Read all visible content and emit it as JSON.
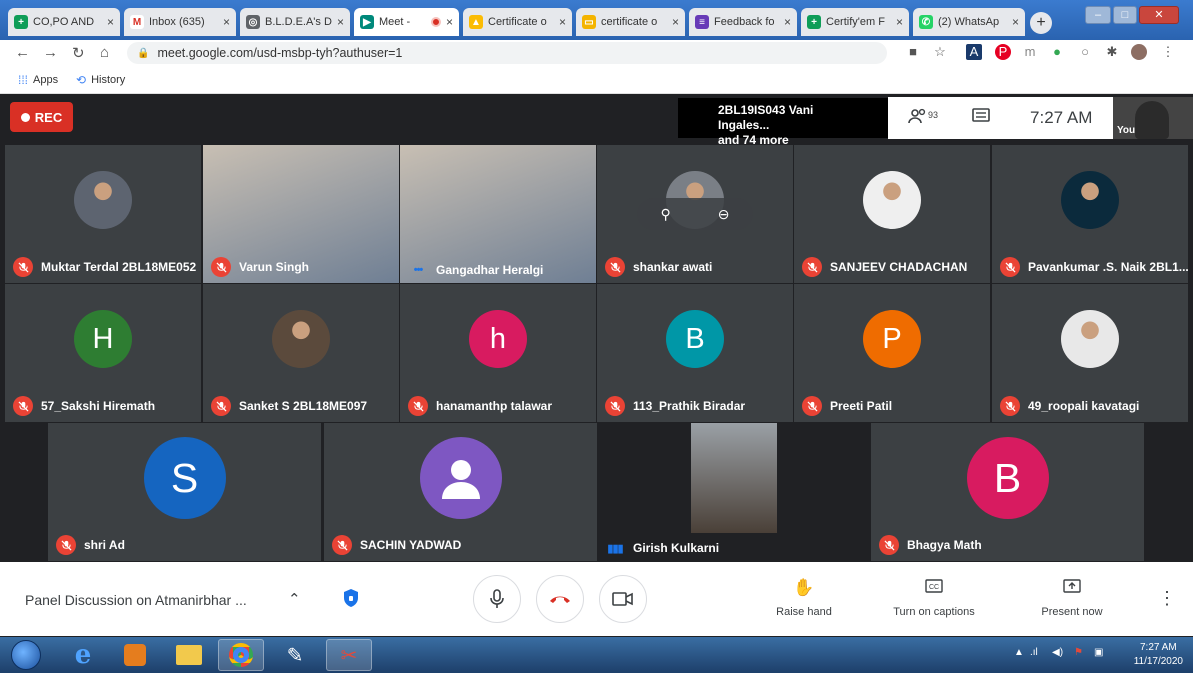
{
  "browser": {
    "tabs": [
      {
        "title": "CO,PO AND",
        "favicon": "sheets-icon",
        "color": "#0f9d58",
        "glyph": "+"
      },
      {
        "title": "Inbox (635)",
        "favicon": "gmail-icon",
        "color": "#ffffff",
        "glyph": "M"
      },
      {
        "title": "B.L.D.E.A's D",
        "favicon": "globe-icon",
        "color": "#5f6368",
        "glyph": "◎"
      },
      {
        "title": "Meet - ",
        "favicon": "meet-icon",
        "color": "#00897b",
        "glyph": "▶"
      },
      {
        "title": "Certificate o",
        "favicon": "drive-icon",
        "color": "#fbbc04",
        "glyph": "▲"
      },
      {
        "title": "certificate o",
        "favicon": "slides-icon",
        "color": "#f4b400",
        "glyph": "▭"
      },
      {
        "title": "Feedback fo",
        "favicon": "forms-icon",
        "color": "#673ab7",
        "glyph": "≡"
      },
      {
        "title": "Certify'em F",
        "favicon": "sheets-icon",
        "color": "#0f9d58",
        "glyph": "+"
      },
      {
        "title": "(2) WhatsAp",
        "favicon": "whatsapp-icon",
        "color": "#25d366",
        "glyph": "✆"
      }
    ],
    "tab_close": "×",
    "new_tab": "+",
    "url": "meet.google.com/usd-msbp-tyh?authuser=1",
    "bookmarks": [
      {
        "label": "Apps",
        "icon": "apps-grid-icon"
      },
      {
        "label": "History",
        "icon": "history-icon"
      }
    ]
  },
  "meet": {
    "rec_label": "REC",
    "speaker_line1": "2BL19IS043 Vani Ingales...",
    "speaker_line2": "and 74 more",
    "participant_count": "93",
    "time": "7:27 AM",
    "self_label": "You",
    "participants": [
      {
        "name": "Muktar Terdal 2BL18ME052",
        "type": "photo",
        "muted": true
      },
      {
        "name": "Varun Singh",
        "type": "video",
        "muted": true
      },
      {
        "name": "Gangadhar Heralgi",
        "type": "video",
        "muted": false,
        "speaking": true
      },
      {
        "name": "shankar awati",
        "type": "photo",
        "muted": true
      },
      {
        "name": "SANJEEV CHADACHAN",
        "type": "photo",
        "muted": true
      },
      {
        "name": "Pavankumar .S. Naik 2BL1...",
        "type": "photo",
        "muted": true
      },
      {
        "name": "57_Sakshi Hiremath",
        "type": "initial",
        "initial": "H",
        "color": "#2e7d32",
        "muted": true
      },
      {
        "name": "Sanket S 2BL18ME097",
        "type": "photo",
        "muted": true
      },
      {
        "name": "hanamanthp talawar",
        "type": "initial",
        "initial": "h",
        "color": "#d81b60",
        "muted": true
      },
      {
        "name": "113_Prathik Biradar",
        "type": "initial",
        "initial": "B",
        "color": "#0097a7",
        "muted": true
      },
      {
        "name": "Preeti Patil",
        "type": "initial",
        "initial": "P",
        "color": "#ef6c00",
        "muted": true
      },
      {
        "name": "49_roopali kavatagi",
        "type": "photo",
        "muted": true
      },
      {
        "name": "shri Ad",
        "type": "initial",
        "initial": "S",
        "color": "#1565c0",
        "muted": true
      },
      {
        "name": "SACHIN YADWAD",
        "type": "generic",
        "color": "#7e57c2",
        "muted": true
      },
      {
        "name": "Girish Kulkarni",
        "type": "video",
        "muted": false,
        "speaking": true
      },
      {
        "name": "Bhagya Math",
        "type": "initial",
        "initial": "B",
        "color": "#d81b60",
        "muted": true
      }
    ]
  },
  "controls": {
    "meeting_title": "Panel Discussion on Atmanirbhar ...",
    "raise_hand": "Raise hand",
    "captions": "Turn on captions",
    "present": "Present now"
  },
  "taskbar": {
    "clock_time": "7:27 AM",
    "clock_date": "11/17/2020"
  }
}
